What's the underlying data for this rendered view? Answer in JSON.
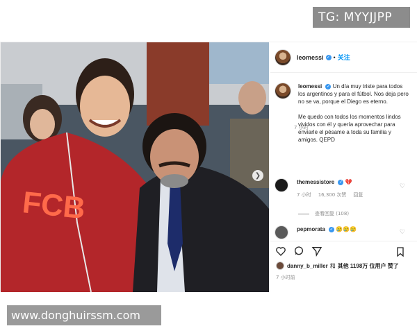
{
  "watermarks": {
    "tg": "TG: MYYJJPP",
    "site": "www.donghuirssm.com"
  },
  "post": {
    "header": {
      "username": "leomessi",
      "verified_icon": "verified-badge",
      "separator": "•",
      "follow_label": "关注"
    },
    "caption": {
      "username": "leomessi",
      "para1": "Un día muy triste para todos los argentinos y para el fútbol. Nos deja pero no se va, porque el Diego es eterno.",
      "para2": "Me quedo con todos los momentos lindos vividos con él y quería aprovechar para enviarle el pésame a toda su familia y amigos. QEPD",
      "time": "7 小时"
    },
    "comments": [
      {
        "username": "themessistore",
        "text": "💔",
        "time": "7 小时",
        "likes": "16,300 次赞",
        "reply_label": "回复",
        "view_replies": "查看回复 (108)"
      },
      {
        "username": "pepmorata",
        "text": "😢😢😢"
      }
    ],
    "likes": {
      "first_user": "danny_b_miller",
      "text_and": "和",
      "text_others": "其他 1198万 位用户 赞了"
    },
    "posted_time": "7 小时前"
  },
  "colors": {
    "accent": "#0095f6",
    "verified": "#3897f0",
    "muted": "#8e8e8e",
    "text": "#262626"
  },
  "icons": [
    "heart-icon",
    "comment-icon",
    "share-icon",
    "bookmark-icon",
    "next-arrow-icon",
    "verified-icon"
  ]
}
